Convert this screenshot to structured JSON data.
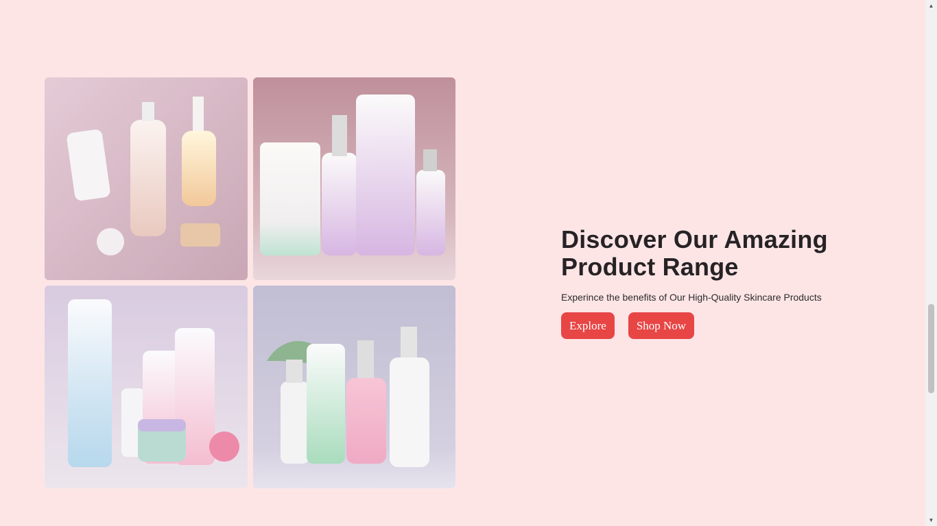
{
  "hero": {
    "title": "Discover Our Amazing Product Range",
    "subtitle": "Experince the benefits of Our High-Quality Skincare Products",
    "explore_label": "Explore",
    "shop_now_label": "Shop Now"
  },
  "gallery": {
    "images": [
      {
        "name": "product-image-1",
        "bg": "#d8bcc6"
      },
      {
        "name": "product-image-2",
        "bg": "#c9a4ad"
      },
      {
        "name": "product-image-3",
        "bg": "#d9cfe0"
      },
      {
        "name": "product-image-4",
        "bg": "#c8c4d6"
      }
    ]
  },
  "colors": {
    "page_bg": "#fde5e6",
    "accent": "#e84545"
  },
  "scrollbar": {
    "up_icon": "triangle-up-icon",
    "down_icon": "triangle-down-icon"
  }
}
